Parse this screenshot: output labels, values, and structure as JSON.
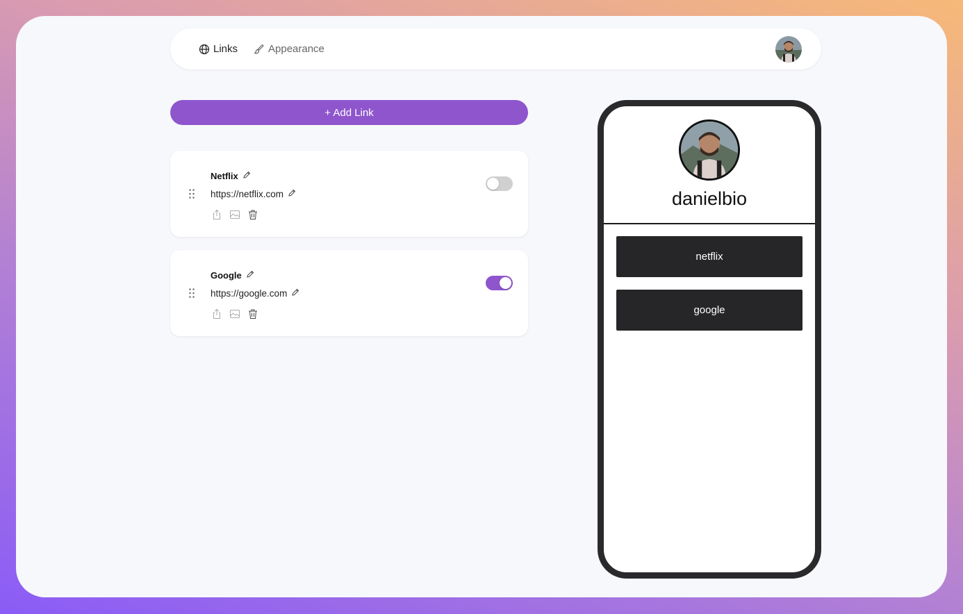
{
  "nav": {
    "tabs": [
      {
        "label": "Links",
        "icon": "globe-icon",
        "active": true
      },
      {
        "label": "Appearance",
        "icon": "brush-icon",
        "active": false
      }
    ]
  },
  "add_link_label": "+ Add Link",
  "links": [
    {
      "title": "Netflix",
      "url": "https://netflix.com",
      "enabled": false
    },
    {
      "title": "Google",
      "url": "https://google.com",
      "enabled": true
    }
  ],
  "preview": {
    "username": "danielbio",
    "buttons": [
      "netflix",
      "google"
    ]
  },
  "colors": {
    "accent": "#8e55cd",
    "phone_frame": "#2a2a2c",
    "preview_button": "#262628",
    "page_bg": "#f7f8fc"
  }
}
